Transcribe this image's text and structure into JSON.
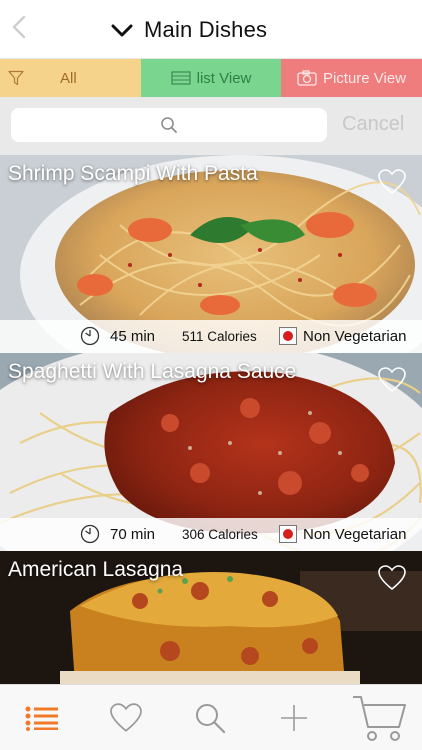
{
  "header": {
    "back_icon": "chevron-left-icon",
    "title": "Main Dishes",
    "title_icon": "chevron-down-icon"
  },
  "filters": {
    "all_label": "All",
    "list_label": "list View",
    "picture_label": "Picture View",
    "colors": {
      "all": "#f6d38b",
      "list": "#7ad68f",
      "picture": "#f07d7d"
    }
  },
  "search": {
    "value": "",
    "cancel_label": "Cancel"
  },
  "recipes": [
    {
      "name": "Shrimp Scampi With Pasta",
      "time": "45 min",
      "calories": "511 Calories",
      "type": "Non Vegetarian"
    },
    {
      "name": "Spaghetti With Lasagna Sauce",
      "time": "70 min",
      "calories": "306 Calories",
      "type": "Non Vegetarian"
    },
    {
      "name": "American Lasagna"
    }
  ],
  "tabbar": {
    "items": [
      "list-icon",
      "heart-icon",
      "search-icon",
      "add-icon",
      "cart-icon"
    ],
    "active_color": "#f07a2a",
    "inactive_color": "#9a9a9a"
  }
}
